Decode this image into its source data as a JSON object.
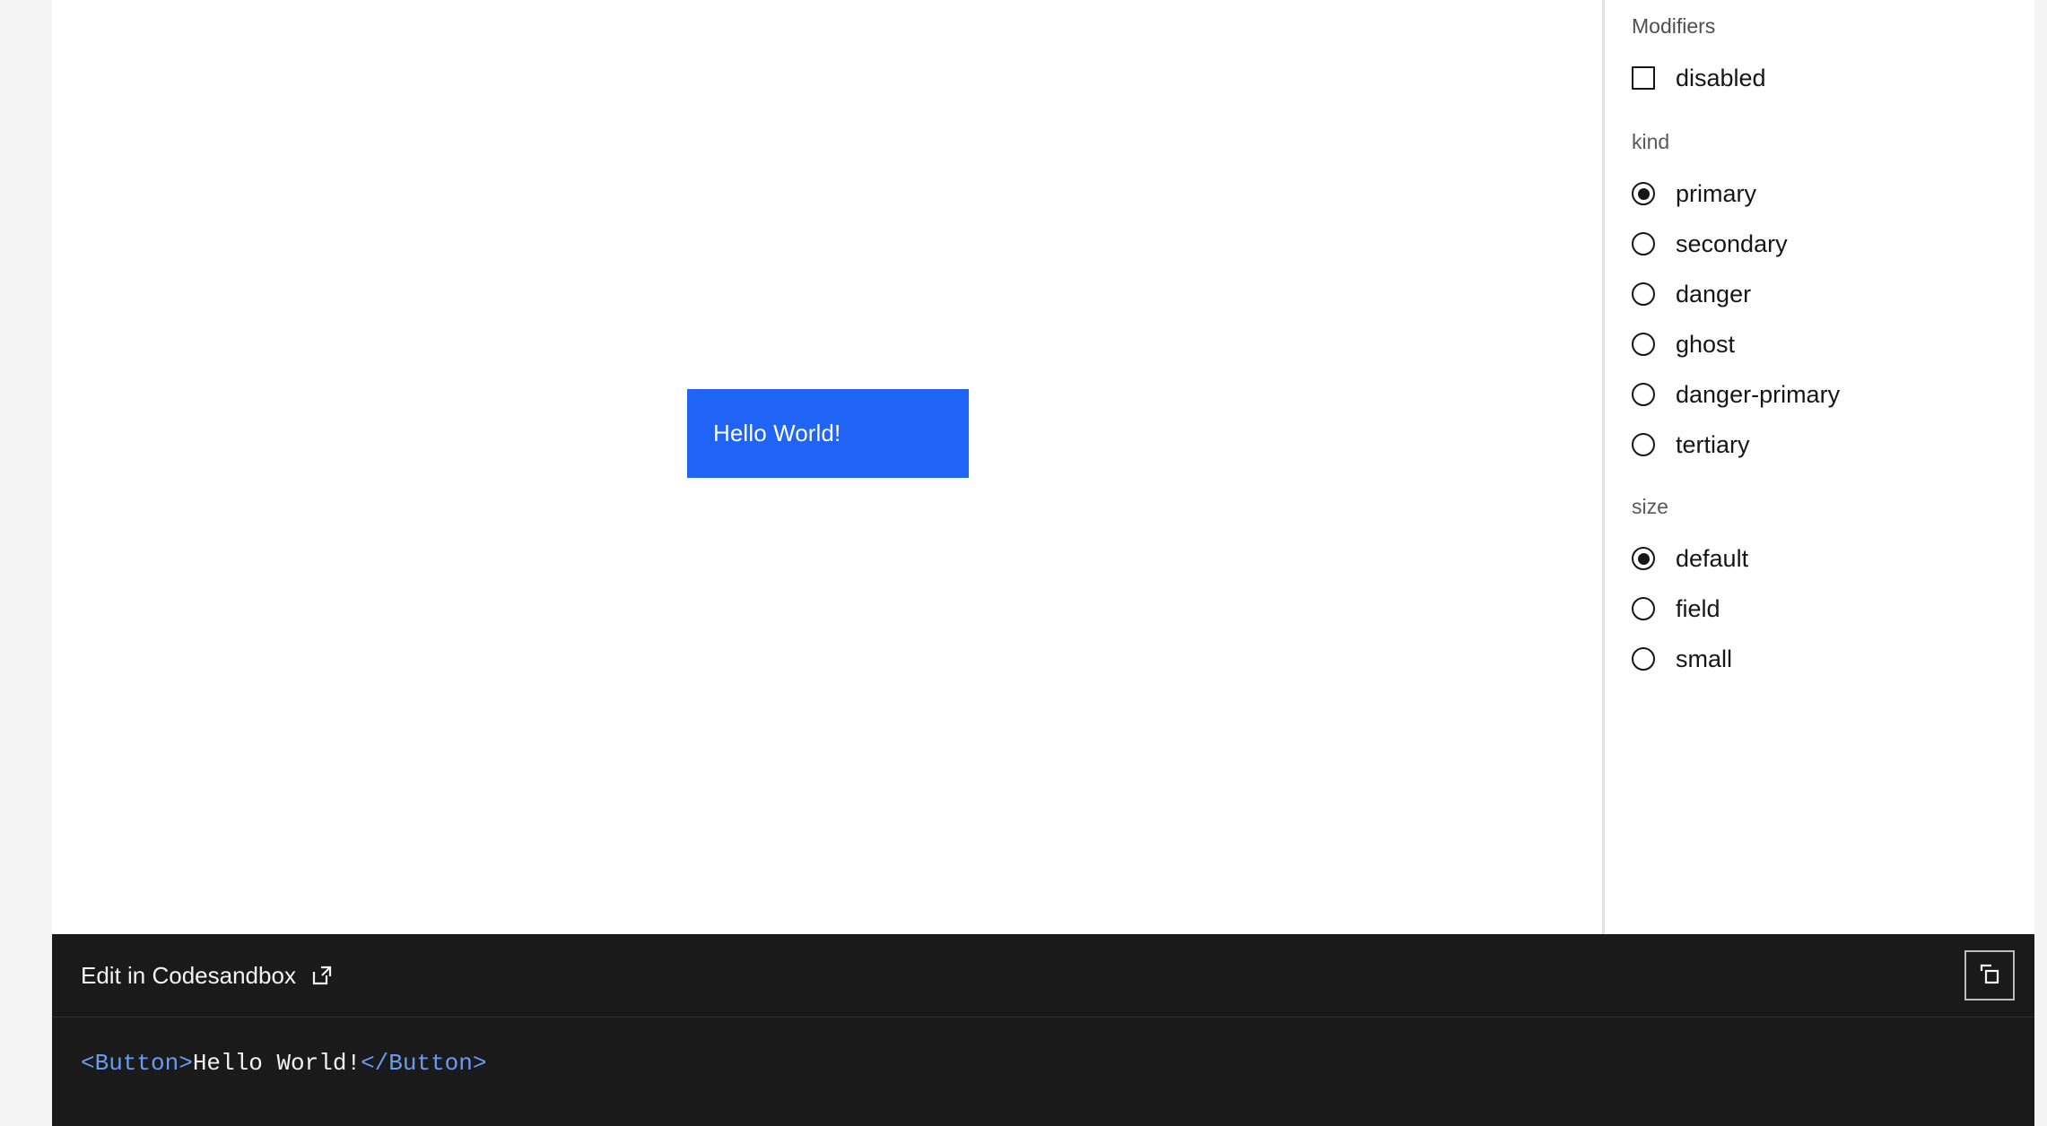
{
  "preview": {
    "button": {
      "label": "Hello World!",
      "accent_color": "#1f64f5",
      "text_color": "#ffffff"
    },
    "background_color": "#ffffff"
  },
  "controls": {
    "groups": [
      {
        "heading": "Modifiers",
        "type": "checkbox",
        "options": [
          {
            "label": "disabled",
            "checked": false
          }
        ]
      },
      {
        "heading": "kind",
        "type": "radio",
        "selected": "primary",
        "options": [
          {
            "label": "primary",
            "checked": true
          },
          {
            "label": "secondary",
            "checked": false
          },
          {
            "label": "danger",
            "checked": false
          },
          {
            "label": "ghost",
            "checked": false
          },
          {
            "label": "danger-primary",
            "checked": false
          },
          {
            "label": "tertiary",
            "checked": false
          }
        ]
      },
      {
        "heading": "size",
        "type": "radio",
        "selected": "default",
        "options": [
          {
            "label": "default",
            "checked": true
          },
          {
            "label": "field",
            "checked": false
          },
          {
            "label": "small",
            "checked": false
          }
        ]
      }
    ]
  },
  "story_panel": {
    "codesandbox_label": "Edit in Codesandbox",
    "external_link_icon": "external-link-icon",
    "copy_icon": "copy-icon",
    "background_color": "#1a1a1a",
    "code": {
      "language": "jsx",
      "full_text": "<Button>Hello World!</Button>",
      "tokens": [
        {
          "text": "<Button>",
          "type": "tag"
        },
        {
          "text": "Hello World!",
          "type": "text"
        },
        {
          "text": "</Button>",
          "type": "tag"
        }
      ],
      "tag_color": "#6a9bf4",
      "text_color": "#f2f2f2"
    }
  }
}
